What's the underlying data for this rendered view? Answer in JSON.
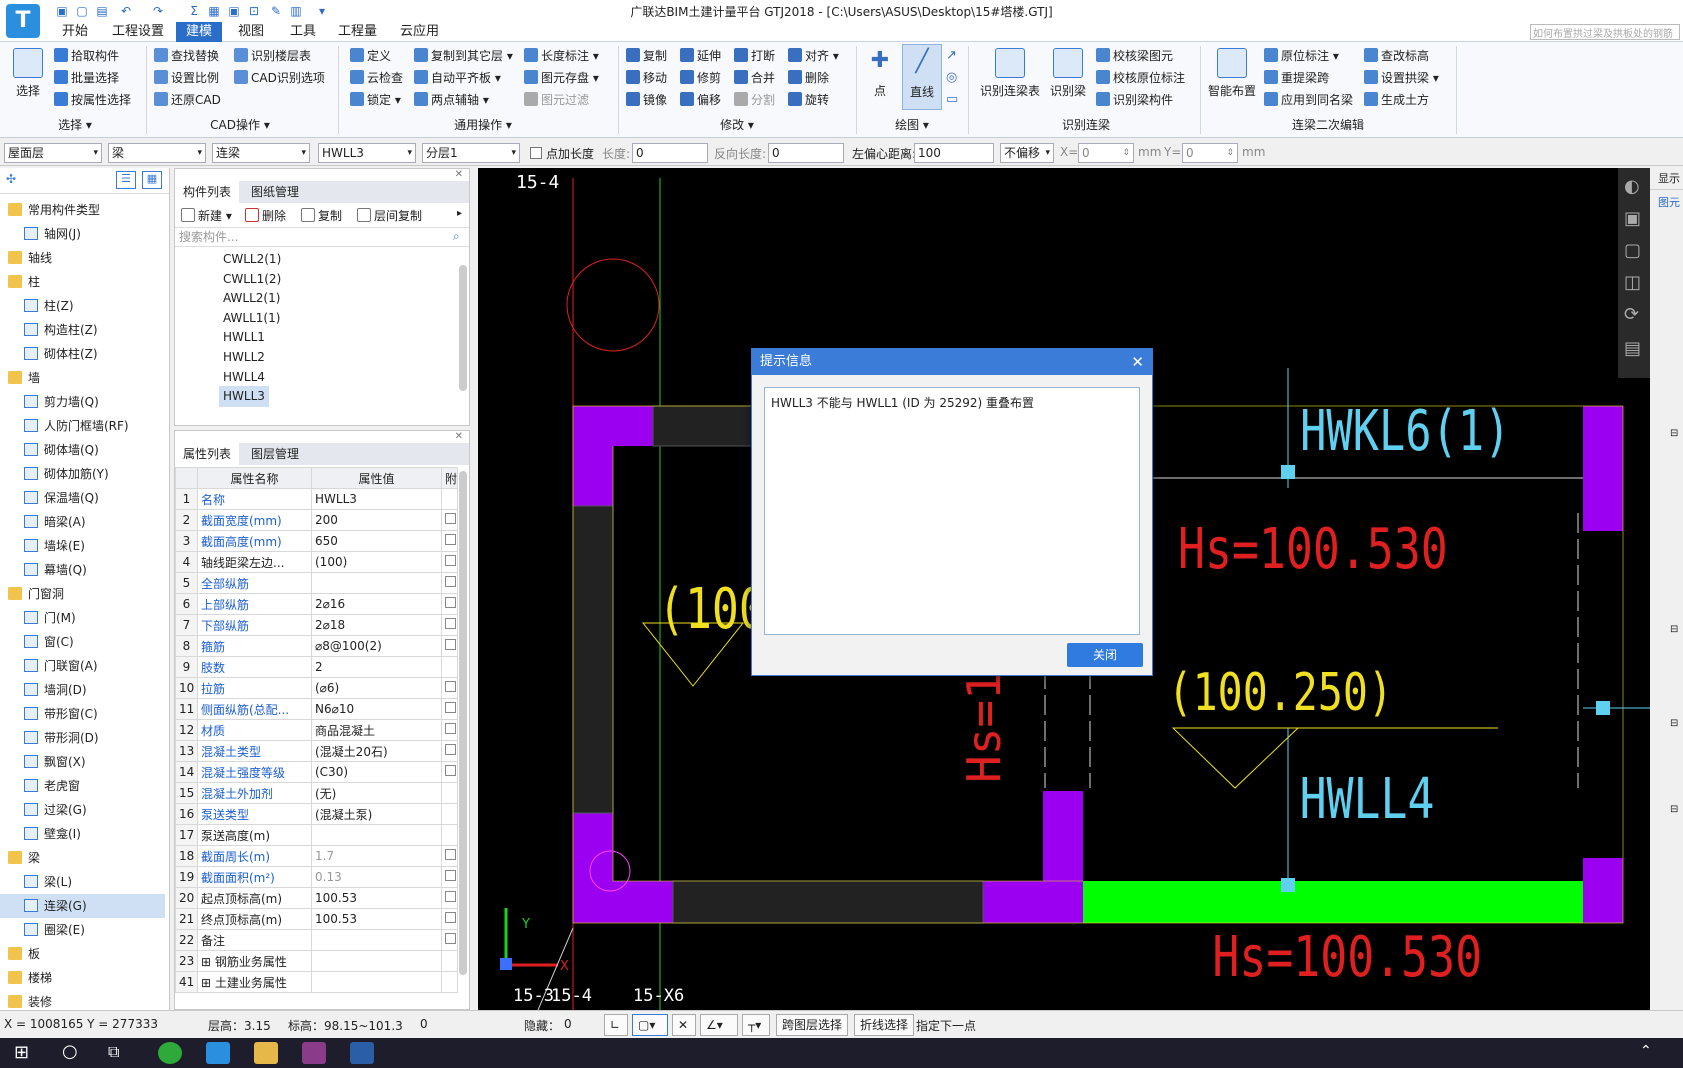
{
  "app": {
    "title": "广联达BIM土建计量平台 GTJ2018 - [C:\\Users\\ASUS\\Desktop\\15#塔楼.GTJ]",
    "search_placeholder": "如何布置拱过梁及拱板处的钢筋"
  },
  "menu": {
    "tabs": [
      "开始",
      "工程设置",
      "建模",
      "视图",
      "工具",
      "工程量",
      "云应用"
    ],
    "active": "建模"
  },
  "ribbon": {
    "select": {
      "big": "选择",
      "items": [
        "拾取构件",
        "批量选择",
        "按属性选择"
      ],
      "label": "选择"
    },
    "cad": {
      "items": [
        "查找替换",
        "识别楼层表",
        "设置比例",
        "CAD识别选项",
        "还原CAD"
      ],
      "label": "CAD操作"
    },
    "common": {
      "items": [
        "定义",
        "复制到其它层",
        "长度标注",
        "云检查",
        "自动平齐板",
        "图元存盘",
        "锁定",
        "两点辅轴",
        "图元过滤"
      ],
      "label": "通用操作"
    },
    "modify": {
      "items": [
        "复制",
        "延伸",
        "打断",
        "对齐",
        "移动",
        "修剪",
        "合并",
        "删除",
        "镜像",
        "偏移",
        "分割",
        "旋转"
      ],
      "label": "修改"
    },
    "draw": {
      "items": [
        "点",
        "直线"
      ],
      "label": "绘图"
    },
    "recognize": {
      "items": [
        "识别连梁表",
        "识别梁",
        "校核梁图元",
        "校核原位标注",
        "识别梁构件"
      ],
      "label": "识别连梁"
    },
    "edit2": {
      "items": [
        "智能布置",
        "原位标注",
        "重提梁跨",
        "应用到同名梁",
        "查改标高",
        "设置拱梁",
        "生成土方"
      ],
      "label": "连梁二次编辑"
    }
  },
  "propbar": {
    "floor": "屋面层",
    "type": "梁",
    "subtype": "连梁",
    "name": "HWLL3",
    "layer": "分层1",
    "add_len": "点加长度",
    "len_label": "长度:",
    "len_val": "0",
    "rev_label": "反向长度:",
    "rev_val": "0",
    "offset_label": "左偏心距离:",
    "offset_val": "100",
    "noshift": "不偏移",
    "x_label": "X=",
    "x_val": "0",
    "y_label": "Y=",
    "y_val": "0",
    "mm1": "mm",
    "mm2": "mm"
  },
  "tree": [
    {
      "t": "常用构件类型",
      "c": 1
    },
    {
      "t": "轴网(J)",
      "c": 0
    },
    {
      "t": "轴线",
      "c": 1
    },
    {
      "t": "柱",
      "c": 1
    },
    {
      "t": "柱(Z)",
      "c": 0
    },
    {
      "t": "构造柱(Z)",
      "c": 0
    },
    {
      "t": "砌体柱(Z)",
      "c": 0
    },
    {
      "t": "墙",
      "c": 1
    },
    {
      "t": "剪力墙(Q)",
      "c": 0
    },
    {
      "t": "人防门框墙(RF)",
      "c": 0
    },
    {
      "t": "砌体墙(Q)",
      "c": 0
    },
    {
      "t": "砌体加筋(Y)",
      "c": 0
    },
    {
      "t": "保温墙(Q)",
      "c": 0
    },
    {
      "t": "暗梁(A)",
      "c": 0
    },
    {
      "t": "墙垛(E)",
      "c": 0
    },
    {
      "t": "幕墙(Q)",
      "c": 0
    },
    {
      "t": "门窗洞",
      "c": 1
    },
    {
      "t": "门(M)",
      "c": 0
    },
    {
      "t": "窗(C)",
      "c": 0
    },
    {
      "t": "门联窗(A)",
      "c": 0
    },
    {
      "t": "墙洞(D)",
      "c": 0
    },
    {
      "t": "带形窗(C)",
      "c": 0
    },
    {
      "t": "带形洞(D)",
      "c": 0
    },
    {
      "t": "飘窗(X)",
      "c": 0
    },
    {
      "t": "老虎窗",
      "c": 0
    },
    {
      "t": "过梁(G)",
      "c": 0
    },
    {
      "t": "壁龛(I)",
      "c": 0
    },
    {
      "t": "梁",
      "c": 1
    },
    {
      "t": "梁(L)",
      "c": 0
    },
    {
      "t": "连梁(G)",
      "c": 0,
      "s": 1
    },
    {
      "t": "圈梁(E)",
      "c": 0
    },
    {
      "t": "板",
      "c": 1
    },
    {
      "t": "楼梯",
      "c": 1
    },
    {
      "t": "装修",
      "c": 1
    }
  ],
  "complist": {
    "tabs": [
      "构件列表",
      "图纸管理"
    ],
    "new": "新建",
    "delete": "删除",
    "copy": "复制",
    "floorcopy": "层间复制",
    "search_placeholder": "搜索构件...",
    "items": [
      "CWLL2(1)",
      "CWLL1(2)",
      "AWLL2(1)",
      "AWLL1(1)",
      "HWLL1",
      "HWLL2",
      "HWLL4",
      "HWLL3"
    ],
    "selected": "HWLL3"
  },
  "proplist": {
    "tabs": [
      "属性列表",
      "图层管理"
    ],
    "col_name": "属性名称",
    "col_val": "属性值",
    "col_add": "附",
    "rows": [
      {
        "n": "1",
        "k": "名称",
        "v": "HWLL3",
        "b": 1,
        "c": 0
      },
      {
        "n": "2",
        "k": "截面宽度(mm)",
        "v": "200",
        "b": 1,
        "c": 1
      },
      {
        "n": "3",
        "k": "截面高度(mm)",
        "v": "650",
        "b": 1,
        "c": 1
      },
      {
        "n": "4",
        "k": "轴线距梁左边...",
        "v": "(100)",
        "b": 0,
        "c": 1
      },
      {
        "n": "5",
        "k": "全部纵筋",
        "v": "",
        "b": 1,
        "c": 1
      },
      {
        "n": "6",
        "k": "上部纵筋",
        "v": "2⌀16",
        "b": 1,
        "c": 1
      },
      {
        "n": "7",
        "k": "下部纵筋",
        "v": "2⌀18",
        "b": 1,
        "c": 1
      },
      {
        "n": "8",
        "k": "箍筋",
        "v": "⌀8@100(2)",
        "b": 1,
        "c": 1
      },
      {
        "n": "9",
        "k": "肢数",
        "v": "2",
        "b": 1,
        "c": 0
      },
      {
        "n": "10",
        "k": "拉筋",
        "v": "(⌀6)",
        "b": 1,
        "c": 1
      },
      {
        "n": "11",
        "k": "侧面纵筋(总配...",
        "v": "N6⌀10",
        "b": 1,
        "c": 1
      },
      {
        "n": "12",
        "k": "材质",
        "v": "商品混凝土",
        "b": 1,
        "c": 1
      },
      {
        "n": "13",
        "k": "混凝土类型",
        "v": "(混凝土20石)",
        "b": 1,
        "c": 1
      },
      {
        "n": "14",
        "k": "混凝土强度等级",
        "v": "(C30)",
        "b": 1,
        "c": 1
      },
      {
        "n": "15",
        "k": "混凝土外加剂",
        "v": "(无)",
        "b": 1,
        "c": 0
      },
      {
        "n": "16",
        "k": "泵送类型",
        "v": "(混凝土泵)",
        "b": 1,
        "c": 0
      },
      {
        "n": "17",
        "k": "泵送高度(m)",
        "v": "",
        "b": 0,
        "c": 0
      },
      {
        "n": "18",
        "k": "截面周长(m)",
        "v": "1.7",
        "b": 1,
        "c": 1,
        "g": 1
      },
      {
        "n": "19",
        "k": "截面面积(m²)",
        "v": "0.13",
        "b": 1,
        "c": 1,
        "g": 1
      },
      {
        "n": "20",
        "k": "起点顶标高(m)",
        "v": "100.53",
        "b": 0,
        "c": 1
      },
      {
        "n": "21",
        "k": "终点顶标高(m)",
        "v": "100.53",
        "b": 0,
        "c": 1
      },
      {
        "n": "22",
        "k": "备注",
        "v": "",
        "b": 0,
        "c": 1
      },
      {
        "n": "23",
        "k": "钢筋业务属性",
        "v": "",
        "b": 0,
        "c": 0,
        "e": 1
      },
      {
        "n": "41",
        "k": "土建业务属性",
        "v": "",
        "b": 0,
        "c": 0,
        "e": 1
      }
    ]
  },
  "canvas": {
    "axes": [
      "15-4",
      "15-3",
      "15-4",
      "15-X6"
    ],
    "labels": {
      "hwkl6": "HWKL6(1)",
      "hs1": "Hs=100.530",
      "hs2": "Hs=100.530",
      "dim1": "(100",
      "dim2": "(100.250)",
      "hwll4": "HWLL4",
      "hsv": "Hs=10"
    },
    "xlabel": "X",
    "ylabel": "Y"
  },
  "dialog": {
    "title": "提示信息",
    "message": "HWLL3 不能与 HWLL1 (ID 为 25292) 重叠布置",
    "close": "关闭"
  },
  "status": {
    "coords": "X = 1008165 Y = 277333",
    "floor_h": "层高：3.15",
    "elev": "标高：98.15~101.3",
    "zero": "0",
    "hidden": "隐藏：",
    "hidden_val": "0",
    "cross": "跨图层选择",
    "poly": "折线选择",
    "next": "指定下一点"
  },
  "colors": {
    "accent": "#2b6ec9",
    "purple": "#9b00f0",
    "green": "#00ff00",
    "cyan": "#5fd0f0",
    "red": "#e02020",
    "yellow": "#f0e020"
  }
}
